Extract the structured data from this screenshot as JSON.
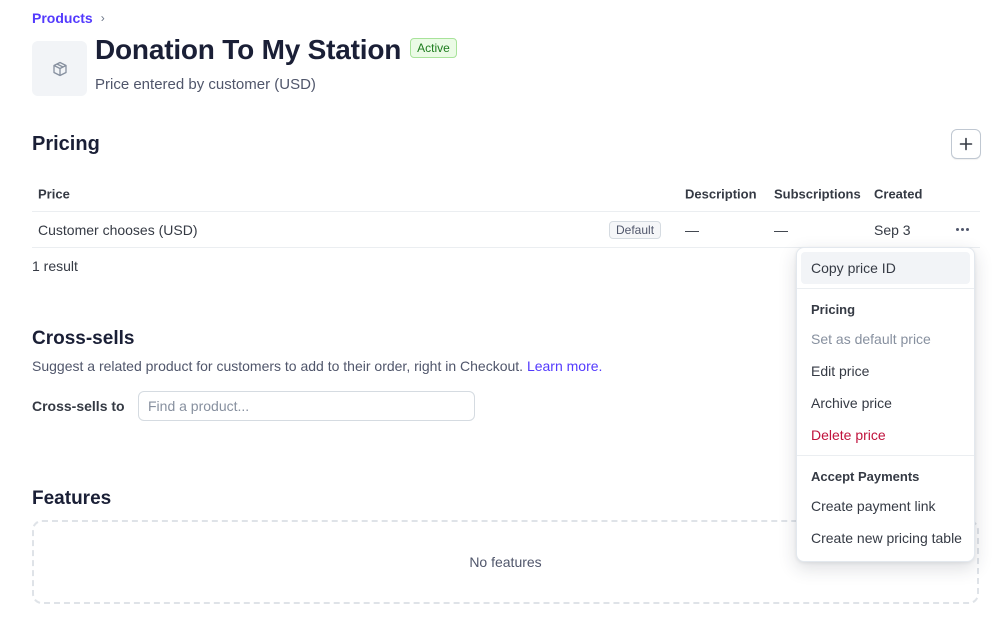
{
  "breadcrumb": {
    "parent": "Products",
    "separator": "›"
  },
  "product": {
    "name": "Donation To My Station",
    "status": "Active",
    "subtitle": "Price entered by customer (USD)",
    "icon": "box-icon"
  },
  "pricing": {
    "title": "Pricing",
    "add_icon": "plus-icon",
    "columns": {
      "price": "Price",
      "description": "Description",
      "subscriptions": "Subscriptions",
      "created": "Created"
    },
    "rows": [
      {
        "price": "Customer chooses (USD)",
        "badge": "Default",
        "description": "—",
        "subscriptions": "—",
        "created": "Sep 3"
      }
    ],
    "result_count": "1 result"
  },
  "cross_sells": {
    "title": "Cross-sells",
    "description": "Suggest a related product for customers to add to their order, right in Checkout.",
    "learn_more": "Learn more.",
    "label": "Cross-sells to",
    "placeholder": "Find a product..."
  },
  "features": {
    "title": "Features",
    "empty": "No features"
  },
  "context_menu": {
    "copy_id": "Copy price ID",
    "pricing_heading": "Pricing",
    "set_default": "Set as default price",
    "edit": "Edit price",
    "archive": "Archive price",
    "delete": "Delete price",
    "payments_heading": "Accept Payments",
    "create_link": "Create payment link",
    "create_table": "Create new pricing table"
  },
  "colors": {
    "accent": "#533afd",
    "active_green": "#1d7c1d",
    "danger": "#c0123c"
  }
}
